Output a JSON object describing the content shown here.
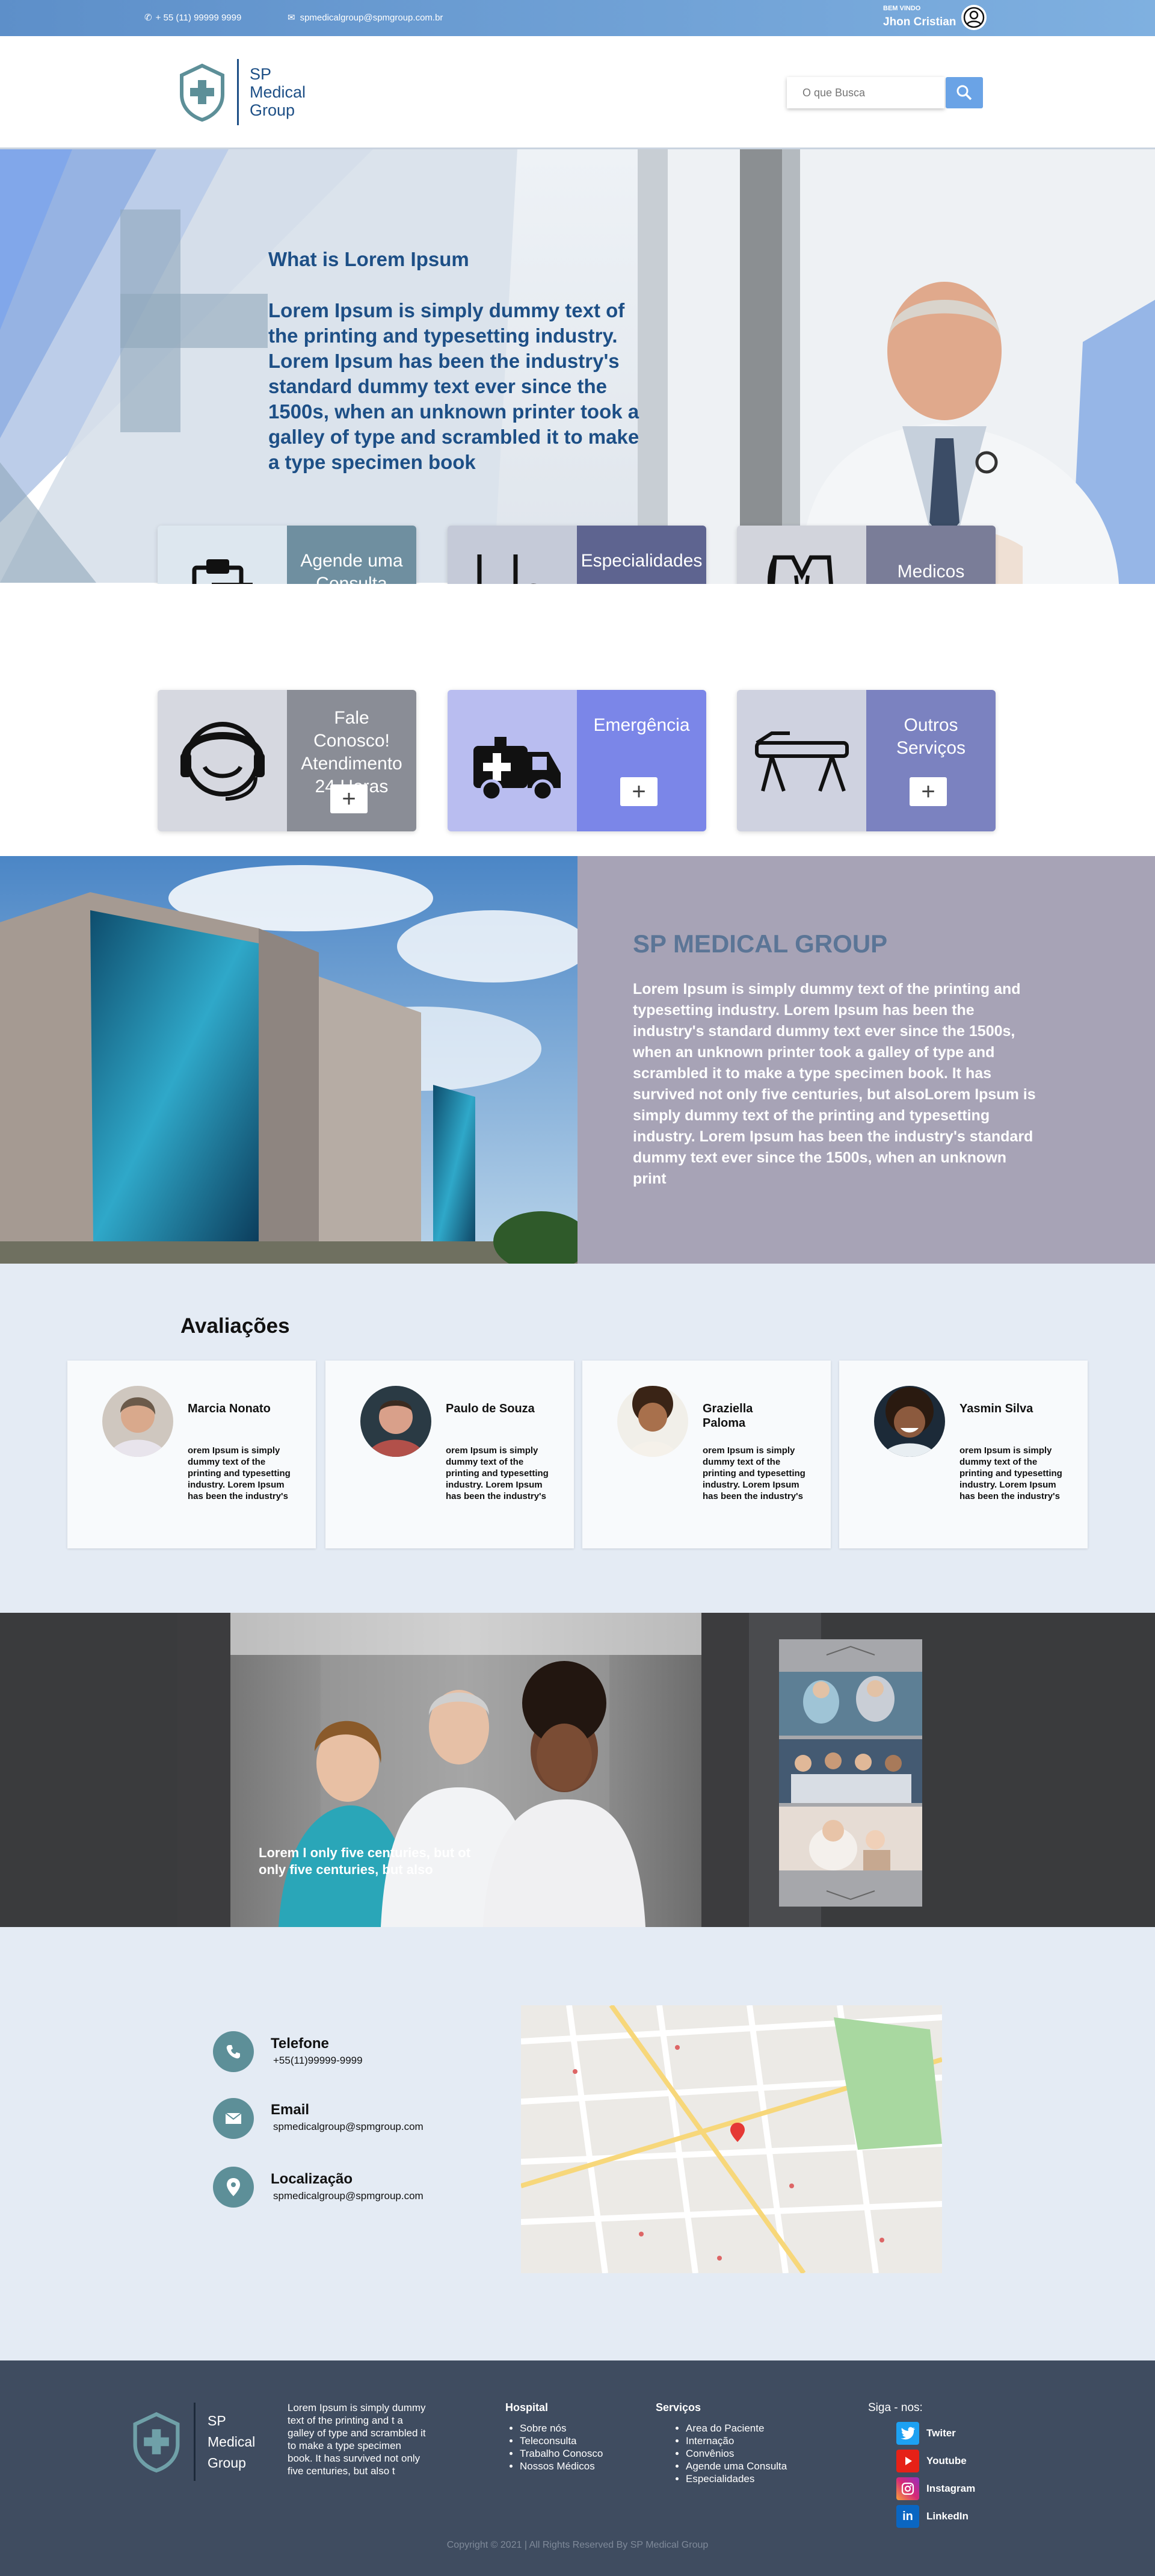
{
  "topbar": {
    "phone": "+ 55 (11) 99999 9999",
    "email": "spmedicalgroup@spmgroup.com.br",
    "welcome": "BEM VINDO",
    "user": "Jhon Cristian"
  },
  "header": {
    "logo_line1": "SP",
    "logo_line2": "Medical",
    "logo_line3": "Group",
    "search_placeholder": "O que Busca"
  },
  "hero": {
    "title": "What is Lorem Ipsum",
    "text": "Lorem Ipsum is simply dummy text of the printing and typesetting industry. Lorem Ipsum has been the industry's standard dummy text ever since the 1500s, when an unknown printer took a galley of type and scrambled it to make a type specimen book"
  },
  "services": [
    {
      "label": "Agende uma Consulta",
      "icon": "clipboard-icon"
    },
    {
      "label": "Especialidades",
      "icon": "stethoscope-icon"
    },
    {
      "label": "Medicos",
      "icon": "doctor-coat-icon"
    },
    {
      "label": "Fale Conosco! Atendimento 24 Horas",
      "icon": "headset-icon"
    },
    {
      "label": "Emergência",
      "icon": "ambulance-icon"
    },
    {
      "label": "Outros Serviços",
      "icon": "exam-table-icon"
    }
  ],
  "about": {
    "title": "SP MEDICAL GROUP",
    "text": "Lorem Ipsum is simply dummy text of the printing and typesetting industry. Lorem Ipsum has been the industry's standard dummy text ever since the 1500s, when an unknown printer took a galley of type and scrambled it to make a type specimen book. It has survived not only five centuries, but alsoLorem Ipsum is simply dummy text of the printing and typesetting industry. Lorem Ipsum has been the industry's standard dummy text ever since the 1500s, when an unknown print"
  },
  "reviews": {
    "title": "Avaliações",
    "items": [
      {
        "name": "Marcia Nonato",
        "text": "orem Ipsum is simply dummy text of the printing and typesetting industry. Lorem Ipsum has been the industry's"
      },
      {
        "name": "Paulo de Souza",
        "text": "orem Ipsum is simply dummy text of the printing and typesetting industry. Lorem Ipsum has been the industry's"
      },
      {
        "name": "Graziella Paloma",
        "text": "orem Ipsum is simply dummy text of the printing and typesetting industry. Lorem Ipsum has been the industry's"
      },
      {
        "name": "Yasmin Silva",
        "text": "orem Ipsum is simply dummy text of the printing and typesetting industry. Lorem Ipsum has been the industry's"
      }
    ]
  },
  "gallery": {
    "caption": "Lorem I only five centuries, but ot only five centuries, but also"
  },
  "contact": {
    "phone_title": "Telefone",
    "phone_value": "+55(11)99999-9999",
    "email_title": "Email",
    "email_value": "spmedicalgroup@spmgroup.com",
    "location_title": "Localização",
    "location_value": "spmedicalgroup@spmgroup.com"
  },
  "footer": {
    "logo_line1": "SP",
    "logo_line2": "Medical",
    "logo_line3": "Group",
    "about_text": "Lorem Ipsum is simply dummy text of the printing and t a galley of type and scrambled it to make a type specimen book. It has survived not only five centuries, but also t",
    "hospital_title": "Hospital",
    "hospital_links": [
      "Sobre nós",
      "Teleconsulta",
      "Trabalho Conosco",
      "Nossos Médicos"
    ],
    "services_title": "Serviços",
    "services_links": [
      "Area do Paciente",
      "Internação",
      "Convênios",
      "Agende uma Consulta",
      "Especialidades"
    ],
    "social_title": "Siga - nos:",
    "social": [
      "Twiter",
      "Youtube",
      "Instagram",
      "LinkedIn"
    ],
    "copyright": "Copyright © 2021 | All Rights Reserved By SP Medical Group"
  },
  "colors": {
    "topbar": "#6a9dd5",
    "accent_blue": "#1d4f86",
    "teal": "#5d8f98",
    "footer": "#3f4c60"
  }
}
